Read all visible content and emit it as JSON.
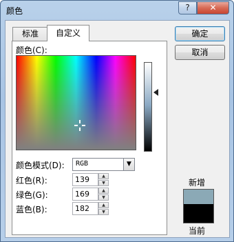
{
  "window": {
    "title": "颜色",
    "help_label": "?",
    "close_label": "✕"
  },
  "tabs": [
    {
      "label": "标准"
    },
    {
      "label": "自定义"
    }
  ],
  "custom": {
    "colors_label": "颜色(C):",
    "color_model_label": "颜色模式(D):",
    "color_model_value": "RGB",
    "red_label": "红色(R):",
    "red_value": "139",
    "green_label": "绿色(G):",
    "green_value": "169",
    "blue_label": "蓝色(B):",
    "blue_value": "182"
  },
  "buttons": {
    "ok_label": "确定",
    "cancel_label": "取消"
  },
  "preview": {
    "new_label": "新增",
    "current_label": "当前",
    "new_color": "#8BA9B6",
    "current_color": "#000000"
  },
  "icons": {
    "dropdown": "chevron-down-icon",
    "spin_up": "spin-up-icon",
    "spin_down": "spin-down-icon",
    "crosshair": "crosshair-icon",
    "luminance_arrow": "luminance-arrow-icon"
  }
}
